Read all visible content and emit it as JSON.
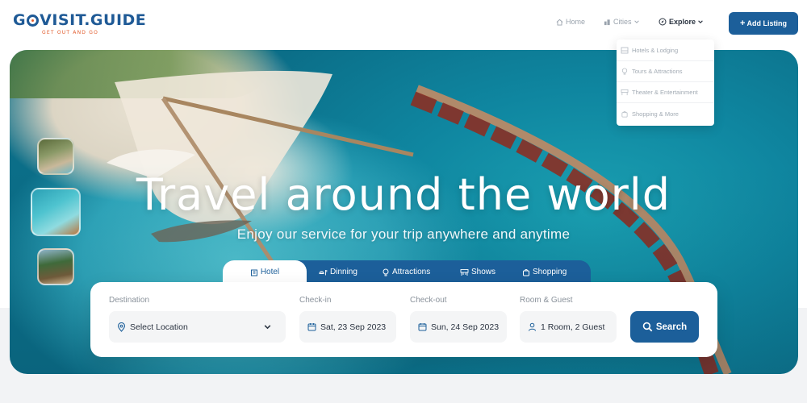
{
  "brand": {
    "name_prefix": "G",
    "name_suffix": "VISIT.GUIDE",
    "tagline": "GET OUT AND GO",
    "primary_color": "#1c5f9a",
    "accent_color": "#e25b2c"
  },
  "nav": {
    "home": "Home",
    "cities": "Cities",
    "explore": "Explore",
    "add_listing": "Add Listing"
  },
  "explore_menu": [
    {
      "label": "Hotels & Lodging",
      "icon": "bed-icon"
    },
    {
      "label": "Tours & Attractions",
      "icon": "balloon-icon"
    },
    {
      "label": "Theater & Entertainment",
      "icon": "theater-icon"
    },
    {
      "label": "Shopping & More",
      "icon": "bag-icon"
    }
  ],
  "hero": {
    "title": "Travel around the world",
    "subtitle": "Enjoy our service for your trip anywhere and anytime"
  },
  "tabs": [
    {
      "label": "Hotel",
      "icon": "hotel-icon",
      "active": true
    },
    {
      "label": "Dinning",
      "icon": "dining-icon",
      "active": false
    },
    {
      "label": "Attractions",
      "icon": "balloon-icon",
      "active": false
    },
    {
      "label": "Shows",
      "icon": "theater-icon",
      "active": false
    },
    {
      "label": "Shopping",
      "icon": "bag-icon",
      "active": false
    }
  ],
  "search": {
    "destination_label": "Destination",
    "destination_value": "Select Location",
    "checkin_label": "Check-in",
    "checkin_value": "Sat, 23 Sep 2023",
    "checkout_label": "Check-out",
    "checkout_value": "Sun, 24 Sep 2023",
    "guests_label": "Room & Guest",
    "guests_value": "1 Room, 2 Guest",
    "button_label": "Search"
  }
}
